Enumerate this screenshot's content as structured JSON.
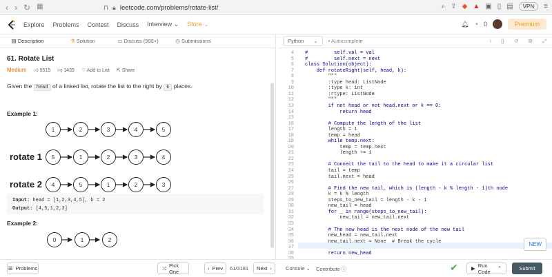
{
  "browser": {
    "url": "leetcode.com/problems/rotate-list/",
    "vpn": "VPN"
  },
  "nav": {
    "items": [
      "Explore",
      "Problems",
      "Contest",
      "Discuss",
      "Interview",
      "Store"
    ],
    "notif_count": "0",
    "premium": "Premium"
  },
  "tabs": [
    "Description",
    "Solution",
    "Discuss (999+)",
    "Submissions"
  ],
  "problem": {
    "title": "61. Rotate List",
    "difficulty": "Medium",
    "likes": "9515",
    "dislikes": "1439",
    "add_to_list": "Add to List",
    "share": "Share",
    "stmt_pre": "Given the",
    "stmt_code1": "head",
    "stmt_mid": "of a linked list, rotate the list to the right by",
    "stmt_code2": "k",
    "stmt_post": "places.",
    "example1": "Example 1:",
    "example2": "Example 2:",
    "row1": [
      "1",
      "2",
      "3",
      "4",
      "5"
    ],
    "rotate1_label": "rotate 1",
    "row2": [
      "5",
      "1",
      "2",
      "3",
      "4"
    ],
    "rotate2_label": "rotate 2",
    "row3": [
      "4",
      "5",
      "1",
      "2",
      "3"
    ],
    "input_label": "Input:",
    "input_value": "head = [1,2,3,4,5], k = 2",
    "output_label": "Output:",
    "output_value": "[4,5,1,2,3]",
    "row4": [
      "0",
      "1",
      "2"
    ]
  },
  "editor": {
    "language": "Python",
    "autocomplete": "Autocomplete",
    "lines": [
      {
        "n": "4",
        "t": "#         self.val = val"
      },
      {
        "n": "5",
        "t": "#         self.next = next"
      },
      {
        "n": "6",
        "t": "class Solution(object):"
      },
      {
        "n": "7",
        "t": "    def rotateRight(self, head, k):"
      },
      {
        "n": "8",
        "t": "        \"\"\""
      },
      {
        "n": "9",
        "t": "        :type head: ListNode"
      },
      {
        "n": "10",
        "t": "        :type k: int"
      },
      {
        "n": "11",
        "t": "        :rtype: ListNode"
      },
      {
        "n": "12",
        "t": "        \"\"\""
      },
      {
        "n": "13",
        "t": "        if not head or not head.next or k == 0:"
      },
      {
        "n": "14",
        "t": "            return head"
      },
      {
        "n": "15",
        "t": ""
      },
      {
        "n": "16",
        "t": "        # Compute the length of the list"
      },
      {
        "n": "17",
        "t": "        length = 1"
      },
      {
        "n": "18",
        "t": "        temp = head"
      },
      {
        "n": "19",
        "t": "        while temp.next:"
      },
      {
        "n": "20",
        "t": "            temp = temp.next"
      },
      {
        "n": "21",
        "t": "            length += 1"
      },
      {
        "n": "22",
        "t": ""
      },
      {
        "n": "23",
        "t": "        # Connect the tail to the head to make it a circular list"
      },
      {
        "n": "24",
        "t": "        tail = temp"
      },
      {
        "n": "25",
        "t": "        tail.next = head"
      },
      {
        "n": "26",
        "t": ""
      },
      {
        "n": "27",
        "t": "        # Find the new tail, which is (length - k % length - 1)th node"
      },
      {
        "n": "28",
        "t": "        k = k % length"
      },
      {
        "n": "29",
        "t": "        steps_to_new_tail = length - k - 1"
      },
      {
        "n": "30",
        "t": "        new_tail = head"
      },
      {
        "n": "31",
        "t": "        for _ in range(steps_to_new_tail):"
      },
      {
        "n": "32",
        "t": "            new_tail = new_tail.next"
      },
      {
        "n": "33",
        "t": ""
      },
      {
        "n": "34",
        "t": "        # The new head is the next node of the new tail"
      },
      {
        "n": "35",
        "t": "        new_head = new_tail.next"
      },
      {
        "n": "36",
        "t": "        new_tail.next = None  # Break the cycle"
      },
      {
        "n": "37",
        "t": ""
      },
      {
        "n": "38",
        "t": "        return new_head"
      },
      {
        "n": "39",
        "t": ""
      }
    ],
    "new_badge": "NEW"
  },
  "bottom": {
    "problems": "Problems",
    "pick_one": "Pick One",
    "prev": "Prev",
    "page": "61/3181",
    "next": "Next",
    "console": "Console",
    "contribute": "Contribute",
    "run_code": "Run Code",
    "submit": "Submit"
  },
  "colors": {
    "accent": "#f0a030",
    "submit": "#455a64",
    "medium": "#ef6c00"
  }
}
